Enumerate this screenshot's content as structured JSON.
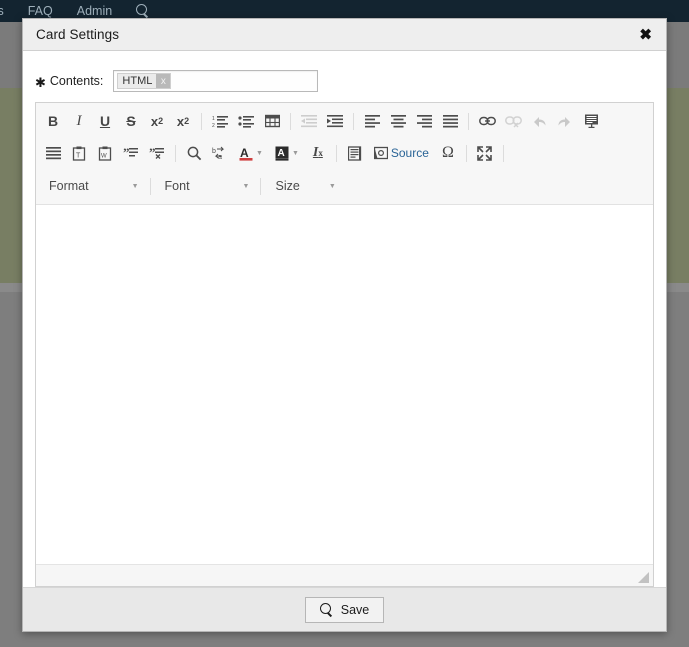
{
  "background": {
    "nav": {
      "items": [
        {
          "label": "ts",
          "name": "nav-link-reports"
        },
        {
          "label": "FAQ",
          "name": "nav-link-faq"
        },
        {
          "label": "Admin",
          "name": "nav-link-admin"
        }
      ],
      "search_icon": "search-icon"
    },
    "colors": {
      "topbar": "#132430",
      "overlay_gray": "#7e7e7e",
      "olive_band": "#787e63"
    }
  },
  "modal": {
    "title": "Card Settings",
    "close_label": "✖",
    "form": {
      "required_marker": "✱",
      "contents_label": "Contents:",
      "contents_tag": "HTML",
      "contents_tag_remove": "x"
    },
    "footer": {
      "save_label": "Save",
      "save_icon": "magnifier-icon"
    }
  },
  "editor": {
    "toolbar_rows": [
      [
        {
          "name": "bold",
          "glyph": "B",
          "type": "text",
          "style": "bold",
          "disabled": false
        },
        {
          "name": "italic",
          "glyph": "I",
          "type": "text",
          "style": "italic",
          "disabled": false
        },
        {
          "name": "underline",
          "glyph": "U",
          "type": "text",
          "style": "underline",
          "disabled": false
        },
        {
          "name": "strikethrough",
          "glyph": "S",
          "type": "text",
          "style": "strike",
          "disabled": false
        },
        {
          "name": "subscript",
          "glyph": "x₂",
          "type": "text",
          "style": "bold",
          "disabled": false
        },
        {
          "name": "superscript",
          "glyph": "x²",
          "type": "text",
          "style": "bold",
          "disabled": false
        },
        {
          "name": "separator"
        },
        {
          "name": "numbered-list",
          "type": "icon",
          "disabled": false
        },
        {
          "name": "bulleted-list",
          "type": "icon",
          "disabled": false
        },
        {
          "name": "table",
          "type": "icon",
          "disabled": false
        },
        {
          "name": "separator"
        },
        {
          "name": "decrease-indent",
          "type": "icon",
          "disabled": true
        },
        {
          "name": "increase-indent",
          "type": "icon",
          "disabled": false
        },
        {
          "name": "separator"
        },
        {
          "name": "align-left",
          "type": "icon",
          "disabled": false
        },
        {
          "name": "align-center",
          "type": "icon",
          "disabled": false
        },
        {
          "name": "align-right",
          "type": "icon",
          "disabled": false
        },
        {
          "name": "align-justify",
          "type": "icon",
          "disabled": false
        },
        {
          "name": "separator"
        },
        {
          "name": "link",
          "type": "icon",
          "disabled": false
        },
        {
          "name": "unlink",
          "type": "icon",
          "disabled": true
        },
        {
          "name": "undo",
          "type": "icon",
          "disabled": true
        },
        {
          "name": "redo",
          "type": "icon",
          "disabled": true
        },
        {
          "name": "templates",
          "type": "icon",
          "disabled": false
        }
      ],
      [
        {
          "name": "blockquote",
          "type": "icon",
          "disabled": false
        },
        {
          "name": "paste-as-plain-text",
          "type": "icon",
          "disabled": false
        },
        {
          "name": "paste-from-word",
          "type": "icon",
          "disabled": false
        },
        {
          "name": "show-blocks",
          "type": "icon",
          "disabled": false
        },
        {
          "name": "remove-quote",
          "type": "icon",
          "disabled": false
        },
        {
          "name": "separator"
        },
        {
          "name": "find",
          "type": "icon",
          "disabled": false
        },
        {
          "name": "replace",
          "type": "icon",
          "disabled": false
        },
        {
          "name": "text-color",
          "type": "icon",
          "disabled": false,
          "caret": true
        },
        {
          "name": "background-color",
          "type": "icon",
          "disabled": false,
          "caret": true
        },
        {
          "name": "remove-format",
          "type": "icon",
          "disabled": false
        },
        {
          "name": "separator"
        },
        {
          "name": "show-blocks-2",
          "type": "icon",
          "disabled": false
        },
        {
          "name": "source",
          "type": "icon-label",
          "label": "Source",
          "disabled": false
        },
        {
          "name": "special-character",
          "glyph": "Ω",
          "type": "text",
          "disabled": false
        },
        {
          "name": "separator"
        },
        {
          "name": "maximize",
          "type": "icon",
          "disabled": false
        },
        {
          "name": "separator"
        }
      ]
    ],
    "combos": [
      {
        "name": "format-combo",
        "label": "Format"
      },
      {
        "name": "font-combo",
        "label": "Font"
      },
      {
        "name": "size-combo",
        "label": "Size"
      }
    ],
    "content": "",
    "resize_handle": "resize-grip-icon"
  }
}
